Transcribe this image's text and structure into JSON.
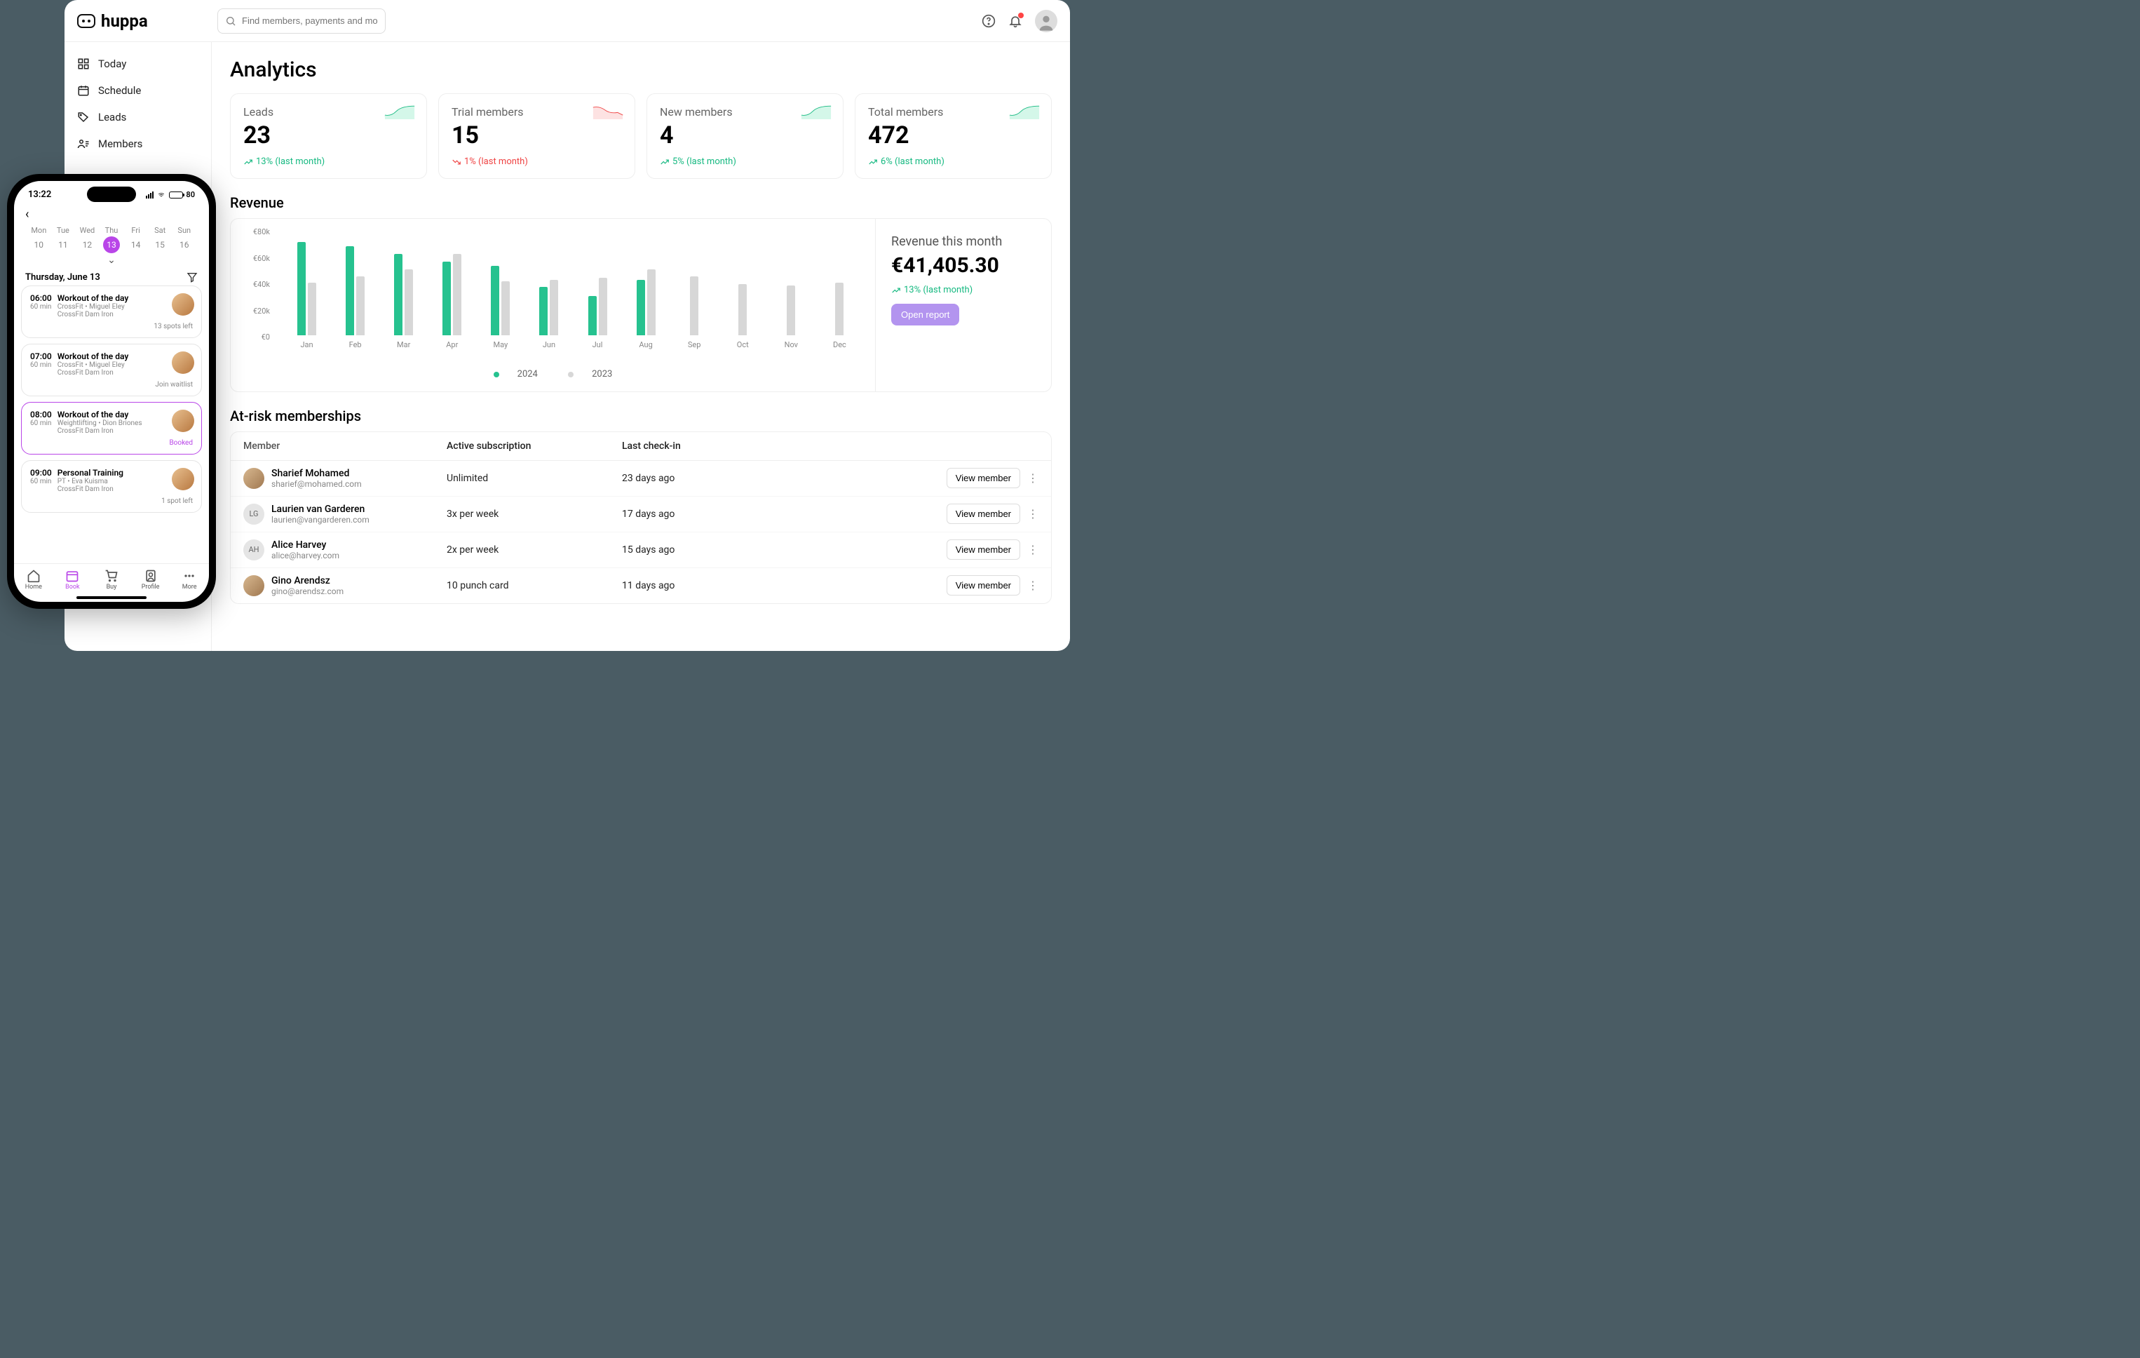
{
  "brand": "huppa",
  "search": {
    "placeholder": "Find members, payments and more.."
  },
  "nav": [
    "Today",
    "Schedule",
    "Leads",
    "Members"
  ],
  "page_title": "Analytics",
  "stats": [
    {
      "label": "Leads",
      "value": "23",
      "trend": "13% (last month)",
      "dir": "up"
    },
    {
      "label": "Trial members",
      "value": "15",
      "trend": "1% (last month)",
      "dir": "down"
    },
    {
      "label": "New members",
      "value": "4",
      "trend": "5% (last month)",
      "dir": "up"
    },
    {
      "label": "Total members",
      "value": "472",
      "trend": "6% (last month)",
      "dir": "up"
    }
  ],
  "revenue_title": "Revenue",
  "revenue_side": {
    "label": "Revenue this month",
    "value": "€41,405.30",
    "trend": "13% (last month)",
    "open_report": "Open report"
  },
  "chart_data": {
    "type": "bar",
    "title": "Revenue",
    "ylabel": "€",
    "ylim": [
      0,
      80000
    ],
    "yticks": [
      "€80k",
      "€60k",
      "€40k",
      "€20k",
      "€0"
    ],
    "categories": [
      "Jan",
      "Feb",
      "Mar",
      "Apr",
      "May",
      "Jun",
      "Jul",
      "Aug",
      "Sep",
      "Oct",
      "Nov",
      "Dec"
    ],
    "series": [
      {
        "name": "2024",
        "color": "#26c28f",
        "values": [
          71000,
          68000,
          62000,
          56000,
          53000,
          37000,
          30000,
          42000,
          null,
          null,
          null,
          null
        ]
      },
      {
        "name": "2023",
        "color": "#d7d7d7",
        "values": [
          40000,
          45000,
          50000,
          62000,
          41000,
          42000,
          44000,
          50000,
          45000,
          39000,
          38000,
          40000
        ]
      }
    ]
  },
  "legend": [
    "2024",
    "2023"
  ],
  "risk_title": "At-risk memberships",
  "risk_headers": [
    "Member",
    "Active subscription",
    "Last check-in"
  ],
  "risk_rows": [
    {
      "name": "Sharief Mohamed",
      "email": "sharief@mohamed.com",
      "sub": "Unlimited",
      "checkin": "23 days ago",
      "avatar": "img"
    },
    {
      "name": "Laurien van Garderen",
      "email": "laurien@vangarderen.com",
      "sub": "3x per week",
      "checkin": "17 days ago",
      "avatar": "LG"
    },
    {
      "name": "Alice Harvey",
      "email": "alice@harvey.com",
      "sub": "2x per week",
      "checkin": "15 days ago",
      "avatar": "AH"
    },
    {
      "name": "Gino Arendsz",
      "email": "gino@arendsz.com",
      "sub": "10 punch card",
      "checkin": "11 days ago",
      "avatar": "img"
    }
  ],
  "view_member": "View member",
  "phone": {
    "time": "13:22",
    "battery": "80",
    "days": [
      {
        "dow": "Mon",
        "num": "10"
      },
      {
        "dow": "Tue",
        "num": "11"
      },
      {
        "dow": "Wed",
        "num": "12"
      },
      {
        "dow": "Thu",
        "num": "13",
        "active": true
      },
      {
        "dow": "Fri",
        "num": "14"
      },
      {
        "dow": "Sat",
        "num": "15"
      },
      {
        "dow": "Sun",
        "num": "16"
      }
    ],
    "day_header": "Thursday, June 13",
    "classes": [
      {
        "time": "06:00",
        "dur": "60 min",
        "title": "Workout of the day",
        "meta1": "CrossFit • Miguel Eley",
        "meta2": "CrossFit Dam Iron",
        "status": "13 spots left"
      },
      {
        "time": "07:00",
        "dur": "60 min",
        "title": "Workout of the day",
        "meta1": "CrossFit • Miguel Eley",
        "meta2": "CrossFit Dam Iron",
        "status": "Join waitlist"
      },
      {
        "time": "08:00",
        "dur": "60 min",
        "title": "Workout of the day",
        "meta1": "Weightlifting • Dion Briones",
        "meta2": "CrossFit Dam Iron",
        "status": "Booked",
        "booked": true
      },
      {
        "time": "09:00",
        "dur": "60 min",
        "title": "Personal Training",
        "meta1": "PT • Eva Kuisma",
        "meta2": "CrossFit Dam Iron",
        "status": "1 spot left"
      }
    ],
    "tabs": [
      "Home",
      "Book",
      "Buy",
      "Profile",
      "More"
    ]
  }
}
